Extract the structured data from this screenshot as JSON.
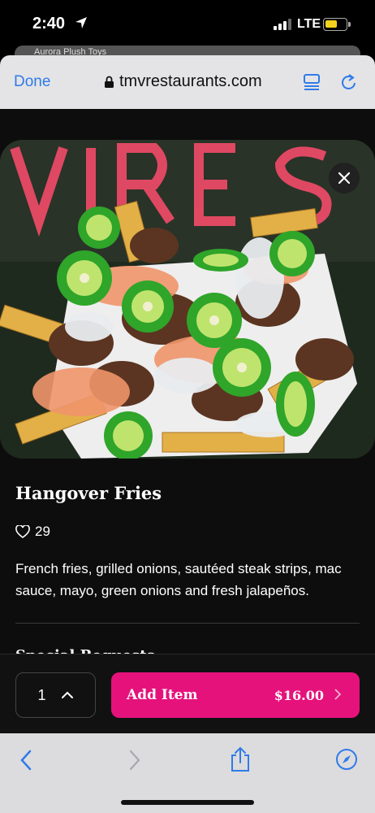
{
  "status_bar": {
    "time": "2:40",
    "network": "LTE"
  },
  "behind_page": {
    "text": "Aurora Plush Toys"
  },
  "browser": {
    "done_label": "Done",
    "url": "tmvrestaurants.com"
  },
  "item": {
    "title": "Hangover Fries",
    "likes": "29",
    "description": "French fries, grilled onions, sautéed steak strips, mac sauce, mayo, green onions and fresh jalapeños.",
    "next_section_partial": "Special Requests"
  },
  "cart": {
    "quantity": "1",
    "add_label": "Add Item",
    "price": "$16.00"
  },
  "colors": {
    "accent": "#e5127c",
    "link": "#2f7be9",
    "battery": "#f4d21b"
  },
  "icons": [
    "location-arrow-icon",
    "signal-icon",
    "battery-icon",
    "lock-icon",
    "reader-icon",
    "reload-icon",
    "close-icon",
    "heart-icon",
    "chevron-up-icon",
    "chevron-right-icon",
    "back-icon",
    "forward-icon",
    "share-icon",
    "compass-icon"
  ]
}
